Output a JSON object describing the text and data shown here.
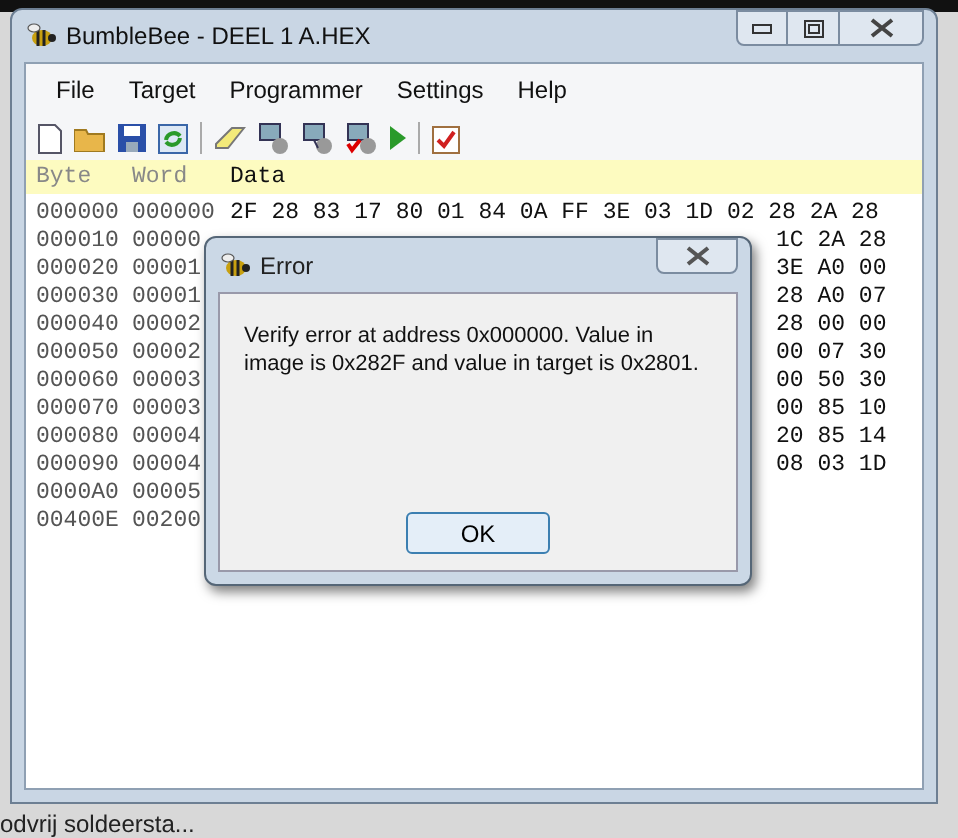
{
  "window": {
    "title": "BumbleBee - DEEL 1 A.HEX"
  },
  "menu": [
    "File",
    "Target",
    "Programmer",
    "Settings",
    "Help"
  ],
  "hex_view": {
    "columns": [
      "Byte",
      "Word",
      "Data"
    ],
    "rows": [
      {
        "byte": "000000",
        "word": "000000",
        "data": "2F 28 83 17 80 01 84 0A FF 3E 03 1D 02 28 2A 28"
      },
      {
        "byte": "000010",
        "word": "00000",
        "data": "1C 2A 28"
      },
      {
        "byte": "000020",
        "word": "00001",
        "data": "3E A0 00"
      },
      {
        "byte": "000030",
        "word": "00001",
        "data": "28 A0 07"
      },
      {
        "byte": "000040",
        "word": "00002",
        "data": "28 00 00"
      },
      {
        "byte": "000050",
        "word": "00002",
        "data": "00 07 30"
      },
      {
        "byte": "000060",
        "word": "00003",
        "data": "00 50 30"
      },
      {
        "byte": "000070",
        "word": "00003",
        "data": "00 85 10"
      },
      {
        "byte": "000080",
        "word": "00004",
        "data": "20 85 14"
      },
      {
        "byte": "000090",
        "word": "00004",
        "data": "08 03 1D"
      },
      {
        "byte": "0000A0",
        "word": "00005"
      },
      {
        "byte": "00400E",
        "word": "00200"
      }
    ]
  },
  "dialog": {
    "title": "Error",
    "message": "Verify error at address 0x000000. Value in image is 0x282F and value in target is 0x2801.",
    "button": "OK"
  },
  "background": {
    "text": "odvrij soldeersta..."
  }
}
